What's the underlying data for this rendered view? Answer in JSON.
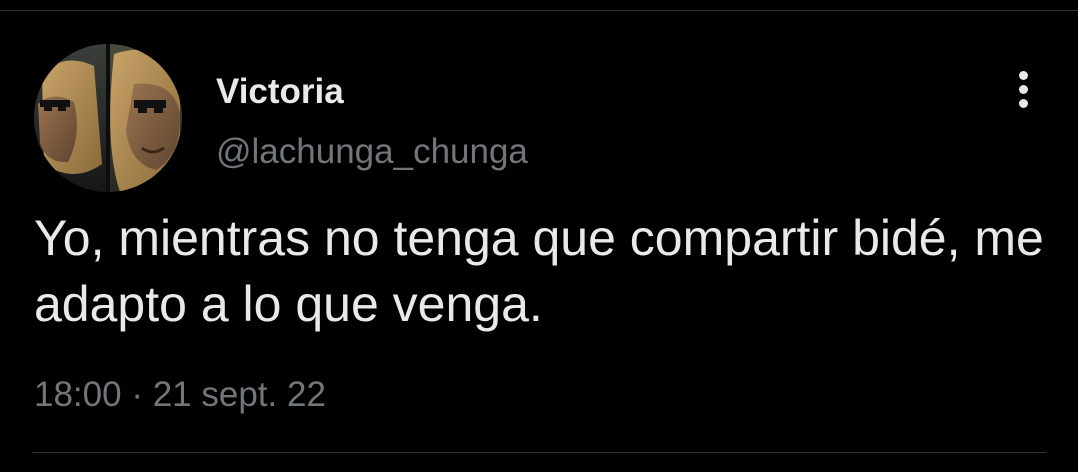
{
  "tweet": {
    "display_name": "Victoria",
    "handle": "@lachunga_chunga",
    "text": "Yo, mientras no tenga que compartir bidé, me adapto a lo que venga.",
    "time": "18:00",
    "separator": "·",
    "date": "21 sept. 22"
  },
  "icons": {
    "more": "more-vertical-icon",
    "avatar": "avatar-image"
  },
  "colors": {
    "background": "#000000",
    "text_primary": "#e7e9ea",
    "text_secondary": "#71767b",
    "divider": "#2f3336"
  }
}
